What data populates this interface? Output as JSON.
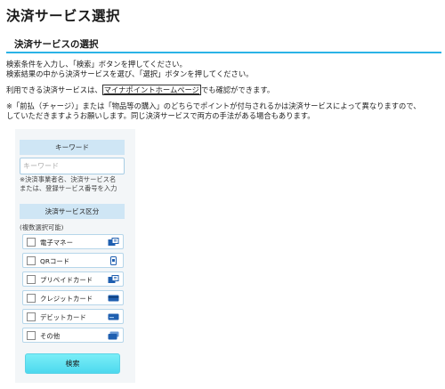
{
  "page": {
    "title": "決済サービス選択"
  },
  "section": {
    "title": "決済サービスの選択"
  },
  "intro": {
    "line1": "検索条件を入力し、「検索」ボタンを押してください。",
    "line2": "検索結果の中から決済サービスを選び、「選択」ボタンを押してください。",
    "line3_pre": "利用できる決済サービスは、",
    "line3_link": "マイナポイントホームページ",
    "line3_post": "でも確認ができます。",
    "note1": "※「前払（チャージ）」または「物品等の購入」のどちらでポイントが付与されるかは決済サービスによって異なりますので、",
    "note2": "していただきますようお願いします。同じ決済サービスで両方の手法がある場合もあります。"
  },
  "search_panel": {
    "keyword_header": "キーワード",
    "keyword_placeholder": "キーワード",
    "keyword_value": "",
    "keyword_hint1": "※決済事業者名、決済サービス名",
    "keyword_hint2": "または、登録サービス番号を入力",
    "category_header": "決済サービス区分",
    "multi_select_note": "(複数選択可能)",
    "options": [
      {
        "label": "電子マネー",
        "icon": "emoney-card-icon",
        "checked": false
      },
      {
        "label": "QRコード",
        "icon": "smartphone-qr-icon",
        "checked": false
      },
      {
        "label": "プリペイドカード",
        "icon": "prepaid-card-icon",
        "checked": false
      },
      {
        "label": "クレジットカード",
        "icon": "credit-card-icon",
        "checked": false
      },
      {
        "label": "デビットカード",
        "icon": "debit-card-icon",
        "checked": false
      },
      {
        "label": "その他",
        "icon": "other-cards-icon",
        "checked": false
      }
    ],
    "search_button": "検索"
  },
  "colors": {
    "accent": "#2bb3e6",
    "panel_header": "#cfe6f5",
    "button": "#5cdcef",
    "icon_blue": "#1f5fb0"
  }
}
